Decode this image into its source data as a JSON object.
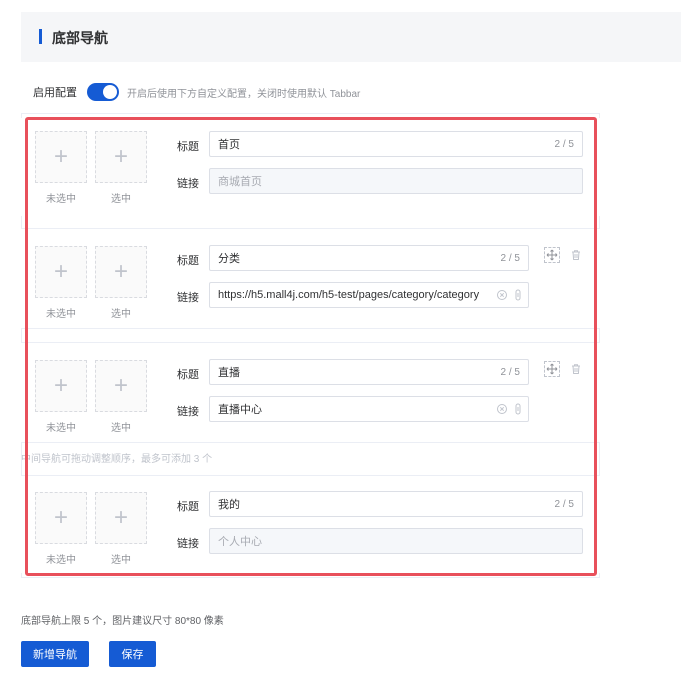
{
  "header": {
    "title": "底部导航"
  },
  "enable": {
    "label": "启用配置",
    "on": true,
    "hint": "开启后使用下方自定义配置，关闭时使用默认 Tabbar"
  },
  "common": {
    "unselected": "未选中",
    "selected": "选中",
    "title_label": "标题",
    "link_label": "链接",
    "plus": "+"
  },
  "items": [
    {
      "title": "首页",
      "count": "2 / 5",
      "link": "商城首页",
      "link_disabled": true
    },
    {
      "title": "分类",
      "count": "2 / 5",
      "link": "https://h5.mall4j.com/h5-test/pages/category/category",
      "link_disabled": false
    },
    {
      "title": "直播",
      "count": "2 / 5",
      "link": "直播中心",
      "link_disabled": false
    },
    {
      "title": "我的",
      "count": "2 / 5",
      "link": "个人中心",
      "link_disabled": true
    }
  ],
  "drag_hint": "中间导航可拖动调整顺序，最多可添加 3 个",
  "footer": {
    "hint": "底部导航上限 5 个，图片建议尺寸 80*80 像素",
    "add_label": "新增导航",
    "save_label": "保存"
  },
  "colors": {
    "primary": "#155bd4",
    "highlight": "#e8505b"
  }
}
